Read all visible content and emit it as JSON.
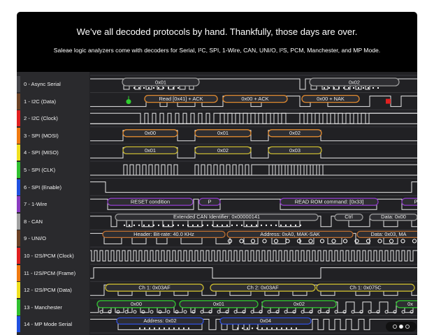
{
  "banner": {
    "headline": "We’ve all decoded protocols by hand.  Thankfully, those days are over.",
    "subline": "Saleae logic analyzers come with decoders for Serial, I²C, SPI, 1-Wire, CAN, UNI/O, I²S, PCM, Manchester, and MP Mode."
  },
  "channels": [
    {
      "label": "0 - Async Serial",
      "color": "#444448"
    },
    {
      "label": "1 - I2C (Data)",
      "color": "#6b4226"
    },
    {
      "label": "2 - I2C (Clock)",
      "color": "#e02020"
    },
    {
      "label": "3 - SPI (MOSI)",
      "color": "#f07a10"
    },
    {
      "label": "4 - SPI (MISO)",
      "color": "#f0e020"
    },
    {
      "label": "5 - SPI (CLK)",
      "color": "#30c030"
    },
    {
      "label": "6 - SPI (Enable)",
      "color": "#2050e0"
    },
    {
      "label": "7 - 1-Wire",
      "color": "#8a3cc0"
    },
    {
      "label": "8 - CAN",
      "color": "#a0a0a0"
    },
    {
      "label": "9 - UNI/O",
      "color": "#6b4226"
    },
    {
      "label": "10 - I2S/PCM (Clock)",
      "color": "#e02020"
    },
    {
      "label": "11 - I2S/PCM (Frame)",
      "color": "#f07a10"
    },
    {
      "label": "12 - I2S/PCM (Data)",
      "color": "#f0e020"
    },
    {
      "label": "13 - Manchester",
      "color": "#30c030"
    },
    {
      "label": "14 - MP Mode Serial",
      "color": "#2050e0"
    }
  ],
  "decodes": {
    "serial_1": "0x01",
    "serial_2": "0x02",
    "i2c_1": "Read [0x41] + ACK",
    "i2c_2": "0x00 + ACK",
    "i2c_3": "0x00 + NAK",
    "mosi_1": "0x00",
    "mosi_2": "0x01",
    "mosi_3": "0x02",
    "miso_1": "0x01",
    "miso_2": "0x02",
    "miso_3": "0x03",
    "ow_1": "RESET condition",
    "ow_2": "P",
    "ow_3": "READ ROM command: [0x33]",
    "can_1": "Extended CAN Identifier: 0x00000141",
    "can_2": "Ctrl",
    "can_3": "Data: 0x00",
    "unio_1": "Header: Bit-rate: 40.0 KHz",
    "unio_2": "Address: 0xA0, MAK-SAK",
    "unio_3": "Data: 0x03, MA",
    "i2s_1": "Ch 1: 0x03AF",
    "i2s_2": "Ch 2: 0x03AF",
    "i2s_3": "Ch 1: 0x075C",
    "man_1": "0x00",
    "man_2": "0x01",
    "man_3": "0x02",
    "man_4": "0x",
    "mp_1": "Address: 0x02",
    "mp_2": "0x04"
  },
  "pager": {
    "count": 3,
    "active_index": 1
  },
  "colors": {
    "trace": "#e8e8e8",
    "bubble_fill": "#2e2e32",
    "serial_bubble": "#9a9a9a",
    "i2c_bubble": "#e08a30",
    "spi_bubble": "#c8b830",
    "onewire_bubble": "#8a3cc0",
    "can_bubble": "#9a9a9a",
    "unio_bubble": "#c07030",
    "manchester_bubble": "#30c030",
    "mp_bubble": "#3050e0",
    "i2c_start": "#30d030",
    "i2c_stop": "#e02020"
  }
}
